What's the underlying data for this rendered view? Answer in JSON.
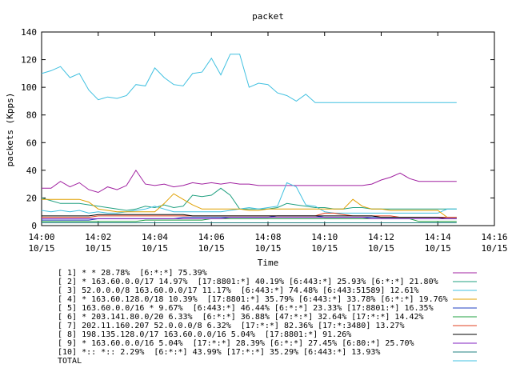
{
  "chart_data": {
    "type": "line",
    "title": "packet",
    "xlabel": "Time",
    "ylabel": "packets (Kpps)",
    "ylim": [
      0,
      140
    ],
    "y_ticks": [
      0,
      20,
      40,
      60,
      80,
      100,
      120,
      140
    ],
    "xlim": [
      "14:00 10/15",
      "14:16 10/15"
    ],
    "x_ticks": [
      {
        "time": "14:00",
        "date": "10/15"
      },
      {
        "time": "14:02",
        "date": "10/15"
      },
      {
        "time": "14:04",
        "date": "10/15"
      },
      {
        "time": "14:06",
        "date": "10/15"
      },
      {
        "time": "14:08",
        "date": "10/15"
      },
      {
        "time": "14:10",
        "date": "10/15"
      },
      {
        "time": "14:12",
        "date": "10/15"
      },
      {
        "time": "14:14",
        "date": "10/15"
      },
      {
        "time": "14:16",
        "date": "10/15"
      }
    ],
    "grid": false,
    "legend_position": "bottom",
    "x": [
      "14:00:00",
      "14:00:20",
      "14:00:40",
      "14:01:00",
      "14:01:20",
      "14:01:40",
      "14:02:00",
      "14:02:20",
      "14:02:40",
      "14:03:00",
      "14:03:20",
      "14:03:40",
      "14:04:00",
      "14:04:20",
      "14:04:40",
      "14:05:00",
      "14:05:20",
      "14:05:40",
      "14:06:00",
      "14:06:20",
      "14:06:40",
      "14:07:00",
      "14:07:20",
      "14:07:40",
      "14:08:00",
      "14:08:20",
      "14:08:40",
      "14:09:00",
      "14:09:20",
      "14:09:40",
      "14:10:00",
      "14:10:20",
      "14:10:40",
      "14:11:00",
      "14:11:20",
      "14:11:40",
      "14:12:00",
      "14:12:20",
      "14:12:40",
      "14:13:00",
      "14:13:20",
      "14:13:40",
      "14:14:00",
      "14:14:20",
      "14:14:40"
    ],
    "series": [
      {
        "name": "[ 1] * * 28.78%  [6:*:*] 75.39%",
        "color": "#a020a0",
        "values": [
          27,
          27,
          32,
          28,
          31,
          26,
          24,
          28,
          26,
          29,
          40,
          30,
          29,
          30,
          28,
          29,
          31,
          30,
          31,
          30,
          31,
          30,
          30,
          29,
          29,
          29,
          29,
          29,
          29,
          29,
          29,
          29,
          29,
          29,
          29,
          30,
          33,
          35,
          38,
          34,
          32,
          32,
          32,
          32,
          32
        ]
      },
      {
        "name": "[ 2] * 163.60.0.0/17 14.97%  [17:8801:*] 40.19% [6:443:*] 25.93% [6:*:*] 21.80%",
        "color": "#20a080",
        "values": [
          20,
          18,
          16,
          16,
          16,
          15,
          14,
          13,
          12,
          11,
          12,
          14,
          13,
          15,
          13,
          14,
          22,
          21,
          22,
          27,
          22,
          12,
          12,
          12,
          12,
          13,
          16,
          15,
          14,
          13,
          13,
          12,
          12,
          13,
          13,
          12,
          12,
          12,
          12,
          12,
          12,
          12,
          12,
          12,
          12
        ]
      },
      {
        "name": "[ 3] 52.0.0.0/8 163.60.0.0/17 11.17%  [6:443:*] 74.48% [6:443:51589] 12.61%",
        "color": "#40c0e0",
        "values": [
          11,
          10,
          11,
          10,
          11,
          9,
          10,
          9,
          9,
          10,
          11,
          12,
          14,
          12,
          10,
          10,
          10,
          10,
          10,
          10,
          11,
          12,
          13,
          12,
          13,
          14,
          31,
          28,
          15,
          14,
          10,
          9,
          9,
          9,
          9,
          9,
          9,
          9,
          9,
          9,
          9,
          9,
          9,
          12,
          12
        ]
      },
      {
        "name": "[ 4] * 163.60.128.0/18 10.39%  [17:8801:*] 35.79% [6:443:*] 33.78% [6:*:*] 19.76%",
        "color": "#e0a000",
        "values": [
          19,
          19,
          19,
          19,
          19,
          17,
          12,
          11,
          10,
          10,
          10,
          10,
          10,
          16,
          23,
          19,
          15,
          12,
          12,
          12,
          12,
          12,
          11,
          11,
          12,
          12,
          12,
          12,
          12,
          12,
          12,
          12,
          12,
          19,
          14,
          12,
          12,
          11,
          11,
          11,
          11,
          11,
          11,
          6,
          6
        ]
      },
      {
        "name": "[ 5] 163.60.0.0/16 * 9.67%  [6:443:*] 46.44% [6:*:*] 23.33% [17:8801:*] 16.35%",
        "color": "#2040c0",
        "values": [
          4,
          4,
          4,
          4,
          4,
          4,
          5,
          5,
          5,
          5,
          5,
          5,
          5,
          5,
          5,
          6,
          6,
          6,
          6,
          6,
          6,
          6,
          6,
          6,
          6,
          7,
          7,
          7,
          7,
          7,
          6,
          6,
          6,
          6,
          6,
          6,
          6,
          6,
          6,
          6,
          6,
          6,
          6,
          6,
          6
        ]
      },
      {
        "name": "[ 6] * 203.141.80.0/20 6.33%  [6:*:*] 36.88% [47:*:*] 32.64% [17:*:*] 14.42%",
        "color": "#20a040",
        "values": [
          3,
          3,
          3,
          3,
          3,
          3,
          3,
          3,
          3,
          3,
          3,
          4,
          4,
          4,
          4,
          4,
          4,
          4,
          5,
          5,
          5,
          5,
          5,
          5,
          5,
          5,
          5,
          5,
          5,
          5,
          5,
          5,
          5,
          5,
          5,
          5,
          5,
          5,
          5,
          5,
          3,
          3,
          3,
          3,
          3
        ]
      },
      {
        "name": "[ 7] 202.11.160.207 52.0.0.0/8 6.32%  [17:*:*] 82.36% [17:*:3480] 13.27%",
        "color": "#e04020",
        "values": [
          6,
          6,
          6,
          6,
          6,
          6,
          7,
          7,
          7,
          7,
          7,
          7,
          7,
          7,
          7,
          7,
          7,
          7,
          7,
          7,
          7,
          7,
          7,
          7,
          7,
          7,
          7,
          7,
          7,
          7,
          9,
          9,
          8,
          7,
          7,
          7,
          7,
          7,
          6,
          6,
          6,
          6,
          6,
          6,
          6
        ]
      },
      {
        "name": "[ 8] 198.135.128.0/17 163.60.0.0/16 5.04%  [17:8801:*] 91.26%",
        "color": "#000000",
        "values": [
          7,
          7,
          7,
          7,
          7,
          7,
          8,
          8,
          8,
          8,
          8,
          8,
          8,
          8,
          8,
          8,
          7,
          7,
          7,
          7,
          7,
          7,
          7,
          7,
          7,
          7,
          7,
          7,
          7,
          7,
          7,
          7,
          7,
          7,
          7,
          7,
          6,
          6,
          6,
          6,
          6,
          6,
          6,
          5,
          5
        ]
      },
      {
        "name": "[ 9] * 163.60.0.0/16 5.04%  [17:*:*] 28.39% [6:*:*] 27.45% [6:80:*] 25.70%",
        "color": "#8020c0",
        "values": [
          5,
          5,
          5,
          5,
          5,
          5,
          5,
          5,
          5,
          5,
          5,
          5,
          5,
          5,
          5,
          5,
          5,
          5,
          5,
          5,
          6,
          6,
          6,
          6,
          6,
          6,
          6,
          6,
          6,
          6,
          6,
          6,
          6,
          6,
          6,
          5,
          5,
          5,
          5,
          5,
          5,
          5,
          5,
          5,
          5
        ]
      },
      {
        "name": "[10] *:: *:: 2.29%  [6:*:*] 43.99% [17:*:*] 35.29% [6:443:*] 13.93%",
        "color": "#208080",
        "values": [
          2,
          2,
          2,
          2,
          2,
          2,
          2,
          2,
          2,
          2,
          2,
          2,
          2,
          2,
          2,
          2,
          2,
          2,
          2,
          2,
          2,
          2,
          2,
          2,
          2,
          2,
          2,
          2,
          2,
          2,
          2,
          2,
          2,
          2,
          2,
          2,
          2,
          2,
          2,
          2,
          2,
          2,
          2,
          2,
          2
        ]
      },
      {
        "name": "TOTAL",
        "color": "#40c0e0",
        "values": [
          110,
          112,
          115,
          107,
          110,
          98,
          91,
          93,
          92,
          94,
          102,
          101,
          114,
          107,
          102,
          101,
          110,
          111,
          121,
          109,
          124,
          124,
          100,
          103,
          102,
          96,
          94,
          90,
          95,
          89,
          89,
          89,
          89,
          89,
          89,
          89,
          89,
          89,
          89,
          89,
          89,
          89,
          89,
          89,
          89
        ]
      }
    ]
  }
}
